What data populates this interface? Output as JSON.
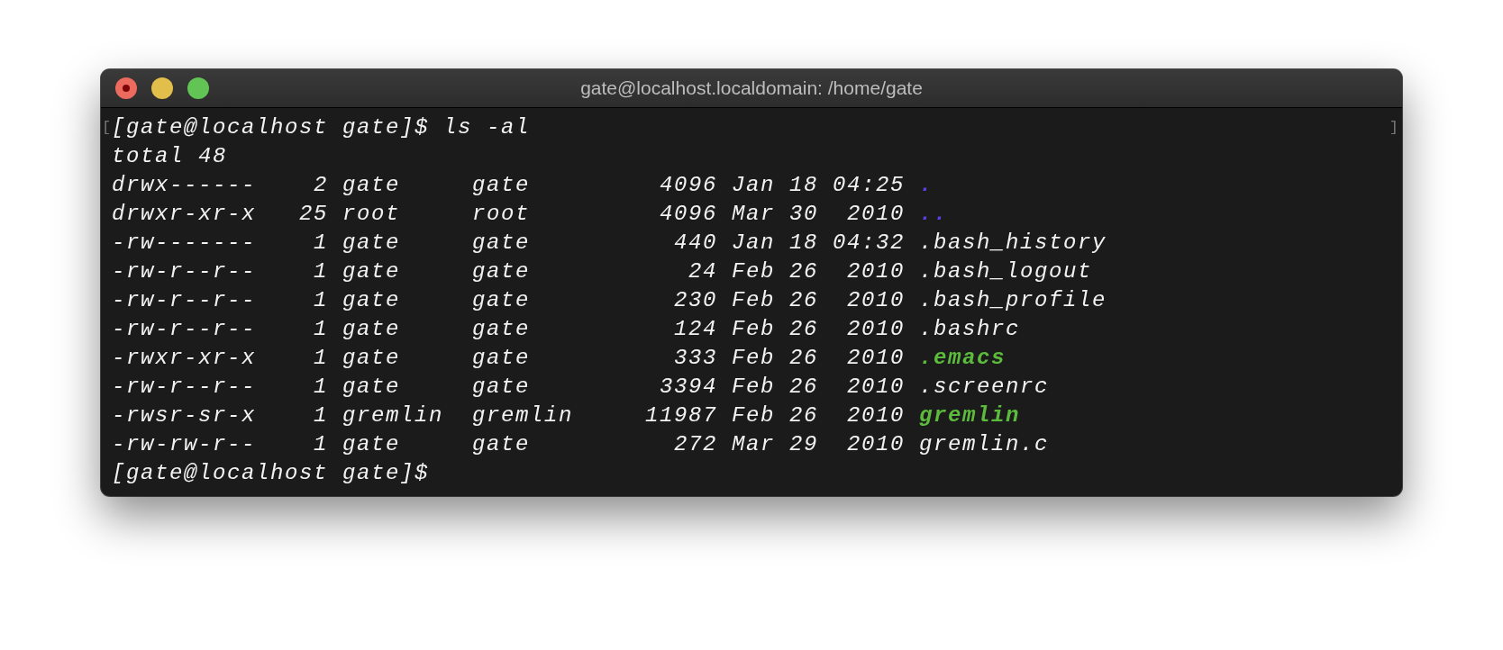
{
  "window": {
    "title": "gate@localhost.localdomain: /home/gate",
    "close_hovered": true
  },
  "terminal": {
    "margin_marks": [
      "[",
      "]"
    ],
    "command_line": "[gate@localhost gate]$ ls -al",
    "total_line": "total 48",
    "rows": [
      {
        "perms": "drwx------",
        "links": "2",
        "owner": "gate",
        "group": "gate",
        "size": "4096",
        "date": "Jan 18 04:25",
        "name": ".",
        "kind": "directory"
      },
      {
        "perms": "drwxr-xr-x",
        "links": "25",
        "owner": "root",
        "group": "root",
        "size": "4096",
        "date": "Mar 30  2010",
        "name": "..",
        "kind": "directory"
      },
      {
        "perms": "-rw-------",
        "links": "1",
        "owner": "gate",
        "group": "gate",
        "size": "440",
        "date": "Jan 18 04:32",
        "name": ".bash_history",
        "kind": "file"
      },
      {
        "perms": "-rw-r--r--",
        "links": "1",
        "owner": "gate",
        "group": "gate",
        "size": "24",
        "date": "Feb 26  2010",
        "name": ".bash_logout",
        "kind": "file"
      },
      {
        "perms": "-rw-r--r--",
        "links": "1",
        "owner": "gate",
        "group": "gate",
        "size": "230",
        "date": "Feb 26  2010",
        "name": ".bash_profile",
        "kind": "file"
      },
      {
        "perms": "-rw-r--r--",
        "links": "1",
        "owner": "gate",
        "group": "gate",
        "size": "124",
        "date": "Feb 26  2010",
        "name": ".bashrc",
        "kind": "file"
      },
      {
        "perms": "-rwxr-xr-x",
        "links": "1",
        "owner": "gate",
        "group": "gate",
        "size": "333",
        "date": "Feb 26  2010",
        "name": ".emacs",
        "kind": "executable"
      },
      {
        "perms": "-rw-r--r--",
        "links": "1",
        "owner": "gate",
        "group": "gate",
        "size": "3394",
        "date": "Feb 26  2010",
        "name": ".screenrc",
        "kind": "file"
      },
      {
        "perms": "-rwsr-sr-x",
        "links": "1",
        "owner": "gremlin",
        "group": "gremlin",
        "size": "11987",
        "date": "Feb 26  2010",
        "name": "gremlin",
        "kind": "executable"
      },
      {
        "perms": "-rw-rw-r--",
        "links": "1",
        "owner": "gate",
        "group": "gate",
        "size": "272",
        "date": "Mar 29  2010",
        "name": "gremlin.c",
        "kind": "file"
      }
    ],
    "prompt": "[gate@localhost gate]$"
  }
}
